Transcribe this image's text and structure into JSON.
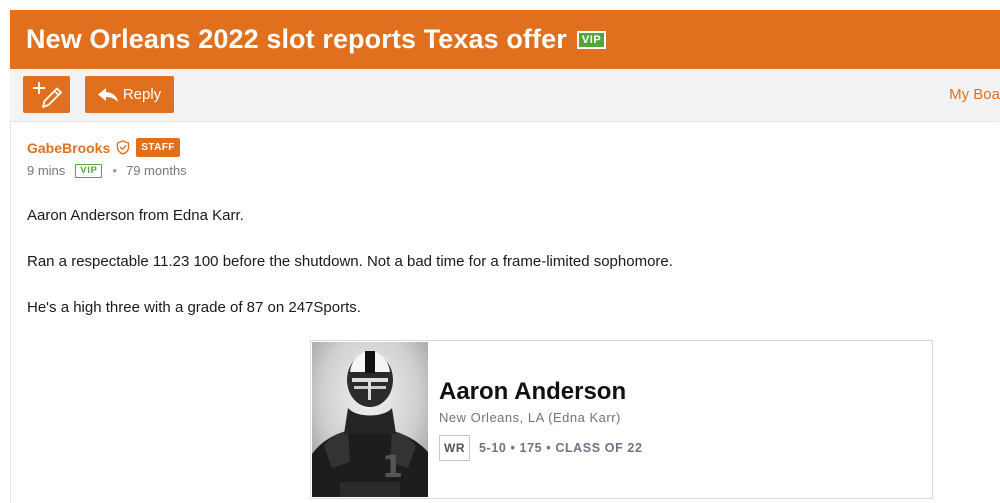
{
  "thread": {
    "title": "New Orleans 2022 slot reports Texas offer",
    "vip_badge": "VIP"
  },
  "toolbar": {
    "new_post_icon": "pen-plus-icon",
    "reply_icon": "reply-arrow-icon",
    "reply_label": "Reply",
    "my_boards_label": "My Boa"
  },
  "post": {
    "author": "GabeBrooks",
    "author_icon": "shield-icon",
    "staff_badge": "STAFF",
    "time_ago": "9 mins",
    "vip_badge": "VIP",
    "separator": "•",
    "membership": "79 months",
    "paragraphs": [
      "Aaron Anderson from Edna Karr.",
      "Ran a respectable 11.23 100 before the shutdown. Not a bad time for a frame-limited sophomore.",
      "He's a high three with a grade of 87 on 247Sports."
    ]
  },
  "player_card": {
    "name": "Aaron Anderson",
    "location": "New Orleans, LA (Edna Karr)",
    "position": "WR",
    "stats": "5-10 • 175 • CLASS OF 22"
  },
  "colors": {
    "brand_orange": "#e0701e",
    "vip_green": "#53a63a",
    "toolbar_bg": "#f3f3f3"
  }
}
